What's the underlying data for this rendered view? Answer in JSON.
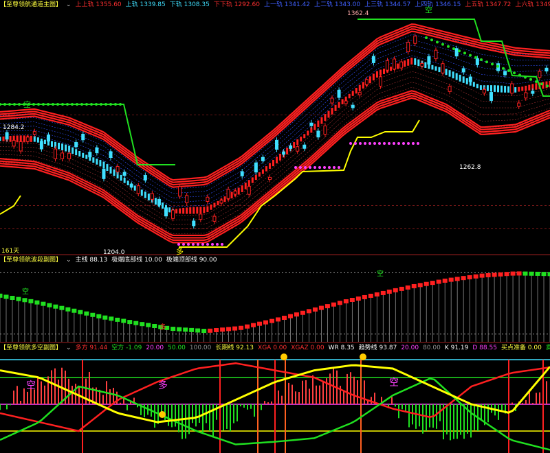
{
  "colors": {
    "bg": "#000000",
    "red": "#ff2020",
    "cyan": "#40e0ff",
    "green": "#20e020",
    "yellow": "#ffff00",
    "magenta": "#ff40ff",
    "gray": "#909090",
    "white": "#ffffff"
  },
  "panel1": {
    "title": "【至尊领航通道主图】",
    "legend": [
      {
        "label": "上上轨",
        "value": "1355.60",
        "color": "#ff3030"
      },
      {
        "label": "上轨",
        "value": "1339.85",
        "color": "#40e0ff"
      },
      {
        "label": "下轨",
        "value": "1308.35",
        "color": "#40e0ff"
      },
      {
        "label": "下下轨",
        "value": "1292.60",
        "color": "#ff3030"
      },
      {
        "label": "上一轨",
        "value": "1341.42",
        "color": "#4060ff"
      },
      {
        "label": "上二轨",
        "value": "1343.00",
        "color": "#4060ff"
      },
      {
        "label": "上三轨",
        "value": "1344.57",
        "color": "#4060ff"
      },
      {
        "label": "上四轨",
        "value": "1346.15",
        "color": "#4060ff"
      },
      {
        "label": "上五轨",
        "value": "1347.72",
        "color": "#ff3030"
      },
      {
        "label": "上六轨",
        "value": "1349.30",
        "color": "#ff3030"
      },
      {
        "label": "上七轨",
        "value": "",
        "color": "#ff3030"
      }
    ],
    "labels": {
      "high": "1362.4",
      "low": "1204.0",
      "left_price": "1284.2",
      "right_low": "1262.8",
      "days": "161天",
      "duo": "多",
      "kong1": "空",
      "kong2": "空"
    }
  },
  "panel2": {
    "title": "【至尊领航波段副图】",
    "legend": [
      {
        "label": "主线",
        "value": "88.13",
        "color": "#ffffff"
      },
      {
        "label": "极端底部线",
        "value": "10.00",
        "color": "#ffffff"
      },
      {
        "label": "极端顶部线",
        "value": "90.00",
        "color": "#ffffff"
      }
    ],
    "labels": {
      "kong1": "空",
      "duo": "多",
      "kong2": "空"
    }
  },
  "panel3": {
    "title": "【至尊领航多空副图】",
    "legend": [
      {
        "label": "多方",
        "value": "91.44",
        "color": "#ff3030"
      },
      {
        "label": "空方",
        "value": "-1.09",
        "color": "#20e020"
      },
      {
        "label": "",
        "value": "20.00",
        "color": "#ff40ff"
      },
      {
        "label": "",
        "value": "50.00",
        "color": "#20e020"
      },
      {
        "label": "",
        "value": "100.00",
        "color": "#909090"
      },
      {
        "label": "长期线",
        "value": "92.13",
        "color": "#ffff40"
      },
      {
        "label": "XGA",
        "value": "0.00",
        "color": "#ff3030"
      },
      {
        "label": "XGAZ",
        "value": "0.00",
        "color": "#ff3030"
      },
      {
        "label": "WR",
        "value": "8.35",
        "color": "#ffffff"
      },
      {
        "label": "趋势线",
        "value": "93.87",
        "color": "#ffffff"
      },
      {
        "label": "",
        "value": "20.00",
        "color": "#ff40ff"
      },
      {
        "label": "",
        "value": "80.00",
        "color": "#909090"
      },
      {
        "label": "K",
        "value": "91.19",
        "color": "#ffffff"
      },
      {
        "label": "D",
        "value": "88.55",
        "color": "#ff40ff"
      },
      {
        "label": "买点准备",
        "value": "0.00",
        "color": "#ffff40"
      },
      {
        "label": "卖点准备",
        "value": "1",
        "color": "#20e020"
      }
    ],
    "labels": {
      "kong1": "空",
      "duo": "多",
      "kong2": "空"
    }
  },
  "chart_data": [
    {
      "type": "line",
      "title": "至尊领航通道主图",
      "x": [
        0,
        10,
        20,
        30,
        40,
        50,
        60,
        70,
        80,
        90,
        100,
        110,
        120,
        130,
        140,
        150,
        160
      ],
      "series": [
        {
          "name": "上上轨",
          "values": [
            1300,
            1302,
            1296,
            1286,
            1268,
            1252,
            1254,
            1268,
            1288,
            1310,
            1332,
            1352,
            1362,
            1356,
            1350,
            1345,
            1343
          ]
        },
        {
          "name": "下下轨",
          "values": [
            1262,
            1260,
            1252,
            1240,
            1222,
            1208,
            1208,
            1222,
            1242,
            1262,
            1284,
            1302,
            1310,
            1300,
            1284,
            1286,
            1296
          ]
        }
      ],
      "price_range": [
        1200,
        1372
      ],
      "annotations": [
        "1362.4",
        "1204.0",
        "1284.2",
        "1262.8"
      ]
    },
    {
      "type": "bar",
      "title": "至尊领航波段副图",
      "main_line": [
        60,
        52,
        42,
        32,
        24,
        17,
        14,
        18,
        28,
        40,
        52,
        62,
        72,
        80,
        86,
        89,
        88.13
      ],
      "levels": {
        "bottom": 10,
        "top": 90
      }
    },
    {
      "type": "line",
      "title": "至尊领航多空副图",
      "series": [
        {
          "name": "多方",
          "values": [
            40,
            30,
            20,
            55,
            75,
            90,
            96,
            88,
            80,
            60,
            45,
            35,
            70,
            85,
            91.44
          ]
        },
        {
          "name": "空方",
          "values": [
            10,
            30,
            70,
            60,
            40,
            20,
            5,
            8,
            12,
            30,
            60,
            80,
            40,
            10,
            -1.09
          ]
        },
        {
          "name": "长期线",
          "values": [
            88,
            80,
            60,
            40,
            30,
            35,
            55,
            75,
            88,
            94,
            90,
            70,
            50,
            40,
            92.13
          ]
        }
      ],
      "levels": [
        20,
        50,
        80,
        100
      ]
    }
  ]
}
